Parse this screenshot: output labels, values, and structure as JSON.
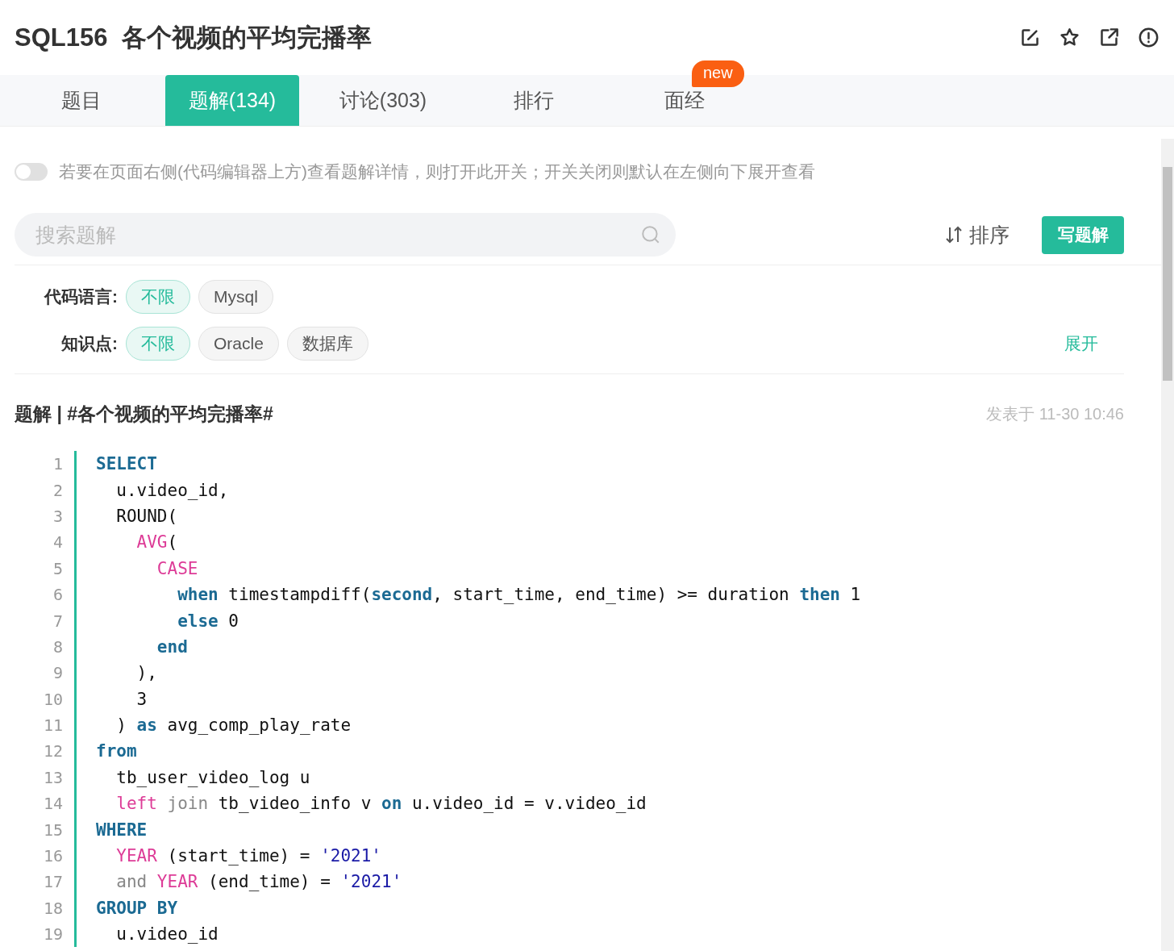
{
  "header": {
    "title": "SQL156  各个视频的平均完播率"
  },
  "tabs": [
    {
      "label": "题目",
      "selected": false
    },
    {
      "label": "题解(134)",
      "selected": true
    },
    {
      "label": "讨论(303)",
      "selected": false
    },
    {
      "label": "排行",
      "selected": false
    },
    {
      "label": "面经",
      "selected": false,
      "badge": "new"
    }
  ],
  "toggle": {
    "on": false,
    "label": "若要在页面右侧(代码编辑器上方)查看题解详情，则打开此开关；开关关闭则默认在左侧向下展开查看"
  },
  "search": {
    "placeholder": "搜索题解"
  },
  "sort": {
    "label": "排序"
  },
  "write_button": {
    "label": "写题解"
  },
  "filters": [
    {
      "label": "代码语言:",
      "options": [
        {
          "label": "不限",
          "selected": true
        },
        {
          "label": "Mysql",
          "selected": false
        }
      ]
    },
    {
      "label": "知识点:",
      "options": [
        {
          "label": "不限",
          "selected": true
        },
        {
          "label": "Oracle",
          "selected": false
        },
        {
          "label": "数据库",
          "selected": false
        }
      ],
      "expand": "展开"
    }
  ],
  "solution": {
    "title": "题解 | #各个视频的平均完播率#",
    "date": "发表于 11-30 10:46",
    "code": [
      {
        "no": "1",
        "tokens": [
          {
            "kind": "keyword",
            "text": "SELECT"
          }
        ]
      },
      {
        "no": "2",
        "tokens": [
          {
            "kind": "plain",
            "text": "  u.video_id,"
          }
        ]
      },
      {
        "no": "3",
        "tokens": [
          {
            "kind": "plain",
            "text": "  ROUND("
          }
        ]
      },
      {
        "no": "4",
        "tokens": [
          {
            "kind": "function",
            "text": "    AVG"
          },
          {
            "kind": "plain",
            "text": "("
          }
        ]
      },
      {
        "no": "5",
        "tokens": [
          {
            "kind": "function",
            "text": "      CASE"
          }
        ]
      },
      {
        "no": "6",
        "tokens": [
          {
            "kind": "keyword",
            "text": "        when"
          },
          {
            "kind": "plain",
            "text": " timestampdiff("
          },
          {
            "kind": "keyword",
            "text": "second"
          },
          {
            "kind": "plain",
            "text": ", start_time, end_time) >= duration "
          },
          {
            "kind": "keyword",
            "text": "then"
          },
          {
            "kind": "plain",
            "text": " 1"
          }
        ]
      },
      {
        "no": "7",
        "tokens": [
          {
            "kind": "keyword",
            "text": "        else"
          },
          {
            "kind": "plain",
            "text": " 0"
          }
        ]
      },
      {
        "no": "8",
        "tokens": [
          {
            "kind": "keyword",
            "text": "      end"
          }
        ]
      },
      {
        "no": "9",
        "tokens": [
          {
            "kind": "plain",
            "text": "    ),"
          }
        ]
      },
      {
        "no": "10",
        "tokens": [
          {
            "kind": "plain",
            "text": "    3"
          }
        ]
      },
      {
        "no": "11",
        "tokens": [
          {
            "kind": "plain",
            "text": "  ) "
          },
          {
            "kind": "keyword",
            "text": "as"
          },
          {
            "kind": "plain",
            "text": " avg_comp_play_rate"
          }
        ]
      },
      {
        "no": "12",
        "tokens": [
          {
            "kind": "keyword",
            "text": "from"
          }
        ]
      },
      {
        "no": "13",
        "tokens": [
          {
            "kind": "plain",
            "text": "  tb_user_video_log u"
          }
        ]
      },
      {
        "no": "14",
        "tokens": [
          {
            "kind": "function",
            "text": "  left"
          },
          {
            "kind": "muted",
            "text": " join"
          },
          {
            "kind": "plain",
            "text": " tb_video_info v "
          },
          {
            "kind": "keyword",
            "text": "on"
          },
          {
            "kind": "plain",
            "text": " u.video_id = v.video_id"
          }
        ]
      },
      {
        "no": "15",
        "tokens": [
          {
            "kind": "keyword",
            "text": "WHERE"
          }
        ]
      },
      {
        "no": "16",
        "tokens": [
          {
            "kind": "function",
            "text": "  YEAR"
          },
          {
            "kind": "plain",
            "text": " (start_time) = "
          },
          {
            "kind": "string",
            "text": "'2021'"
          }
        ]
      },
      {
        "no": "17",
        "tokens": [
          {
            "kind": "muted",
            "text": "  and"
          },
          {
            "kind": "function",
            "text": " YEAR"
          },
          {
            "kind": "plain",
            "text": " (end_time) = "
          },
          {
            "kind": "string",
            "text": "'2021'"
          }
        ]
      },
      {
        "no": "18",
        "tokens": [
          {
            "kind": "keyword",
            "text": "GROUP BY"
          }
        ]
      },
      {
        "no": "19",
        "tokens": [
          {
            "kind": "plain",
            "text": "  u.video_id"
          }
        ]
      }
    ]
  }
}
